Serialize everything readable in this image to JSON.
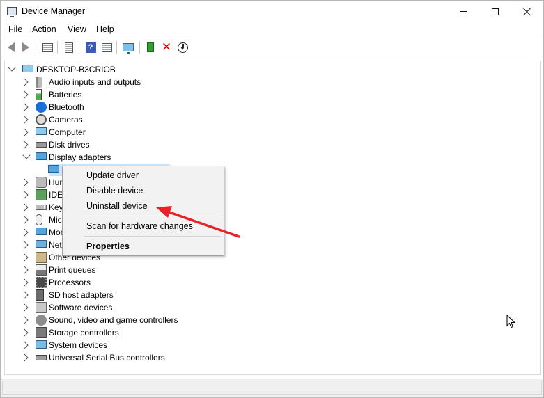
{
  "window": {
    "title": "Device Manager"
  },
  "menu": [
    "File",
    "Action",
    "View",
    "Help"
  ],
  "toolbar": {
    "icons": [
      "back-arrow-icon",
      "forward-arrow-icon",
      "properties-icon",
      "driver-details-icon",
      "help-icon",
      "view-icon",
      "scan-monitor-icon",
      "update-driver-icon",
      "uninstall-x-icon",
      "download-icon"
    ]
  },
  "tree": {
    "root": "DESKTOP-B3CRIOB",
    "categories": [
      "Audio inputs and outputs",
      "Batteries",
      "Bluetooth",
      "Cameras",
      "Computer",
      "Disk drives",
      "Display adapters",
      "Hum",
      "IDE",
      "Key",
      "Mic",
      "Mon",
      "Net",
      "Other devices",
      "Print queues",
      "Processors",
      "SD host adapters",
      "Software devices",
      "Sound, video and game controllers",
      "Storage controllers",
      "System devices",
      "Universal Serial Bus controllers"
    ],
    "expanded_category": "Display adapters"
  },
  "context_menu": {
    "items": [
      "Update driver",
      "Disable device",
      "Uninstall device",
      "Scan for hardware changes",
      "Properties"
    ]
  },
  "colors": {
    "selection": "#cce4f7",
    "annotation_arrow": "#e8232a",
    "menu_bg": "#f2f2f2"
  }
}
